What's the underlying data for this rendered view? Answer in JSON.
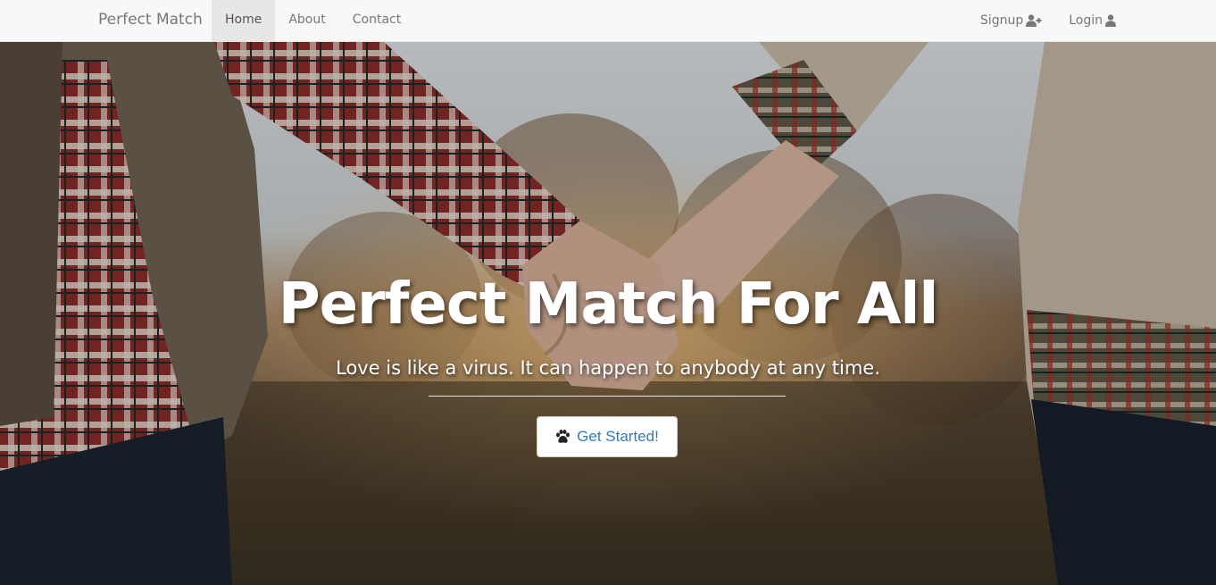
{
  "navbar": {
    "brand": "Perfect Match",
    "links": [
      {
        "label": "Home",
        "active": true
      },
      {
        "label": "About",
        "active": false
      },
      {
        "label": "Contact",
        "active": false
      }
    ],
    "right": [
      {
        "label": "Signup",
        "icon": "user-plus-icon"
      },
      {
        "label": "Login",
        "icon": "user-icon"
      }
    ]
  },
  "hero": {
    "title": "Perfect Match For All",
    "subtitle": "Love is like a virus. It can happen to anybody at any time.",
    "cta_label": "Get Started!",
    "cta_icon": "paw-icon",
    "background": "photo-couple-holding-hands"
  },
  "colors": {
    "navbar_bg": "#f8f8f8",
    "active_tab_bg": "#e7e7e7",
    "link_color": "#777777",
    "cta_text": "#337ab7"
  }
}
